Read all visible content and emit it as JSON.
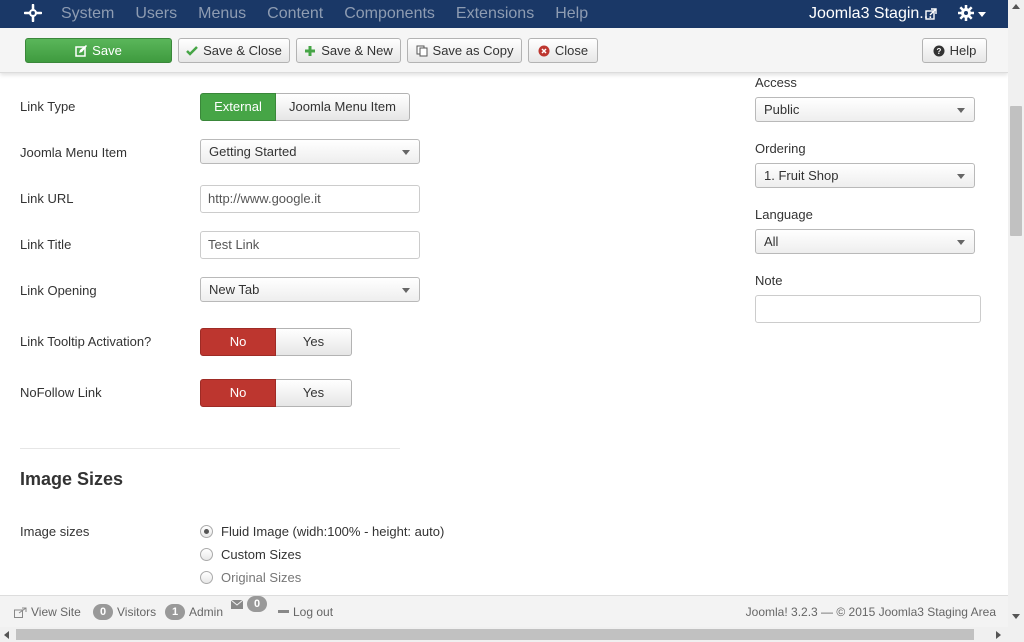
{
  "navbar": {
    "menu": [
      "System",
      "Users",
      "Menus",
      "Content",
      "Components",
      "Extensions",
      "Help"
    ],
    "site_name": "Joomla3 Stagin...",
    "icons": {
      "logo": "joomla-logo-icon",
      "external": "external-link-icon",
      "settings": "gear-icon"
    }
  },
  "toolbar": {
    "save": "Save",
    "save_close": "Save & Close",
    "save_new": "Save & New",
    "save_copy": "Save as Copy",
    "close": "Close",
    "help": "Help"
  },
  "form": {
    "link_type": {
      "label": "Link Type",
      "options": [
        "External",
        "Joomla Menu Item"
      ],
      "selected": "External"
    },
    "menu_item": {
      "label": "Joomla Menu Item",
      "value": "Getting Started"
    },
    "link_url": {
      "label": "Link URL",
      "value": "http://www.google.it"
    },
    "link_title": {
      "label": "Link Title",
      "value": "Test Link"
    },
    "link_opening": {
      "label": "Link Opening",
      "value": "New Tab"
    },
    "tooltip": {
      "label": "Link Tooltip Activation?",
      "no": "No",
      "yes": "Yes",
      "selected": "No"
    },
    "nofollow": {
      "label": "NoFollow Link",
      "no": "No",
      "yes": "Yes",
      "selected": "No"
    }
  },
  "image_section": {
    "title": "Image Sizes",
    "label": "Image sizes",
    "options": [
      "Fluid Image (widh:100% - height: auto)",
      "Custom Sizes",
      "Original Sizes"
    ],
    "selected": "Fluid Image (widh:100% - height: auto)"
  },
  "sidebar": {
    "access": {
      "label": "Access",
      "value": "Public"
    },
    "ordering": {
      "label": "Ordering",
      "value": "1. Fruit Shop"
    },
    "language": {
      "label": "Language",
      "value": "All"
    },
    "note": {
      "label": "Note",
      "value": ""
    }
  },
  "status": {
    "view_site": "View Site",
    "visitors_count": "0",
    "visitors": "Visitors",
    "admin_count": "1",
    "admin": "Admin",
    "messages_count": "0",
    "logout": "Log out",
    "copyright": "Joomla! 3.2.3  —  © 2015 Joomla3 Staging Area"
  },
  "colors": {
    "navbar": "#1a3867",
    "green": "#46a546",
    "red": "#bd362f"
  }
}
